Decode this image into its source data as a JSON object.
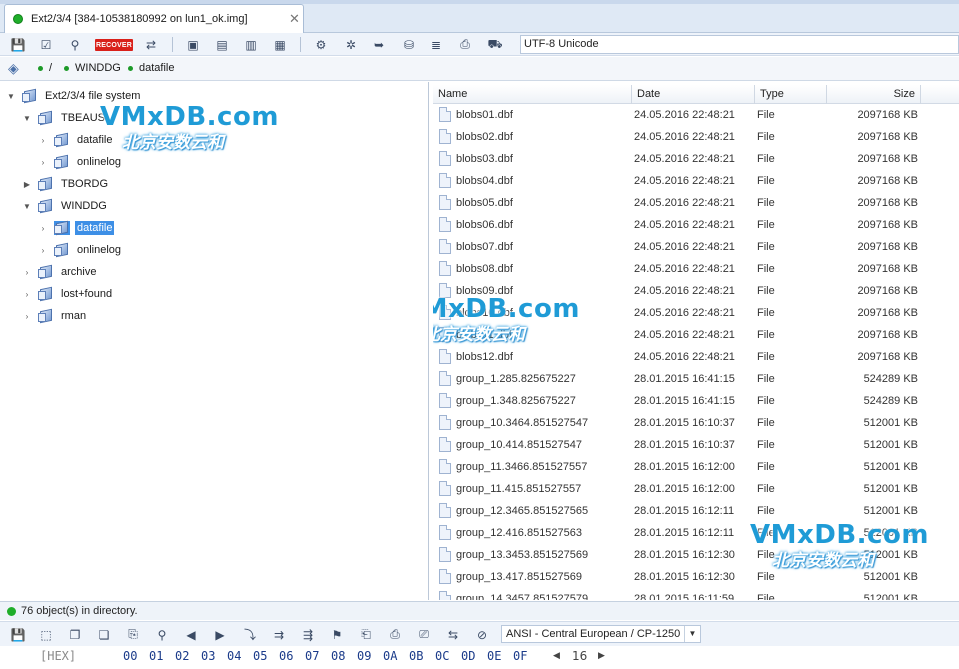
{
  "tab": {
    "title": "Ext2/3/4 [384-10538180992 on lun1_ok.img]",
    "close": "✕"
  },
  "toolbar": {
    "icons": [
      "save-icon",
      "checklist-icon",
      "binoculars-icon",
      "recover-button",
      "transfer-icon",
      "copy-icon",
      "merge-icon",
      "export-icon",
      "table-icon",
      "gear-icon",
      "settings-icon",
      "arrow-icon",
      "database-icon",
      "document-icon",
      "file-icon",
      "package-icon"
    ],
    "recover_label": "RECOVER",
    "encoding": "UTF-8 Unicode"
  },
  "path": {
    "root": "/",
    "folder": "WINDDG",
    "sub": "datafile"
  },
  "tree": {
    "root": "Ext2/3/4 file system",
    "nodes": [
      {
        "label": "TBEAUS"
      },
      {
        "label": "datafile"
      },
      {
        "label": "onlinelog"
      },
      {
        "label": "TBORDG"
      },
      {
        "label": "WINDDG"
      },
      {
        "label": "datafile"
      },
      {
        "label": "onlinelog"
      },
      {
        "label": "archive"
      },
      {
        "label": "lost+found"
      },
      {
        "label": "rman"
      }
    ]
  },
  "columns": {
    "name": "Name",
    "date": "Date",
    "type": "Type",
    "size": "Size"
  },
  "files": [
    {
      "name": "blobs01.dbf",
      "date": "24.05.2016 22:48:21",
      "type": "File",
      "size": "2097168 KB"
    },
    {
      "name": "blobs02.dbf",
      "date": "24.05.2016 22:48:21",
      "type": "File",
      "size": "2097168 KB"
    },
    {
      "name": "blobs03.dbf",
      "date": "24.05.2016 22:48:21",
      "type": "File",
      "size": "2097168 KB"
    },
    {
      "name": "blobs04.dbf",
      "date": "24.05.2016 22:48:21",
      "type": "File",
      "size": "2097168 KB"
    },
    {
      "name": "blobs05.dbf",
      "date": "24.05.2016 22:48:21",
      "type": "File",
      "size": "2097168 KB"
    },
    {
      "name": "blobs06.dbf",
      "date": "24.05.2016 22:48:21",
      "type": "File",
      "size": "2097168 KB"
    },
    {
      "name": "blobs07.dbf",
      "date": "24.05.2016 22:48:21",
      "type": "File",
      "size": "2097168 KB"
    },
    {
      "name": "blobs08.dbf",
      "date": "24.05.2016 22:48:21",
      "type": "File",
      "size": "2097168 KB"
    },
    {
      "name": "blobs09.dbf",
      "date": "24.05.2016 22:48:21",
      "type": "File",
      "size": "2097168 KB"
    },
    {
      "name": "blobs10.dbf",
      "date": "24.05.2016 22:48:21",
      "type": "File",
      "size": "2097168 KB"
    },
    {
      "name": "blobs11.dbf",
      "date": "24.05.2016 22:48:21",
      "type": "File",
      "size": "2097168 KB"
    },
    {
      "name": "blobs12.dbf",
      "date": "24.05.2016 22:48:21",
      "type": "File",
      "size": "2097168 KB"
    },
    {
      "name": "group_1.285.825675227",
      "date": "28.01.2015 16:41:15",
      "type": "File",
      "size": "524289 KB"
    },
    {
      "name": "group_1.348.825675227",
      "date": "28.01.2015 16:41:15",
      "type": "File",
      "size": "524289 KB"
    },
    {
      "name": "group_10.3464.851527547",
      "date": "28.01.2015 16:10:37",
      "type": "File",
      "size": "512001 KB"
    },
    {
      "name": "group_10.414.851527547",
      "date": "28.01.2015 16:10:37",
      "type": "File",
      "size": "512001 KB"
    },
    {
      "name": "group_11.3466.851527557",
      "date": "28.01.2015 16:12:00",
      "type": "File",
      "size": "512001 KB"
    },
    {
      "name": "group_11.415.851527557",
      "date": "28.01.2015 16:12:00",
      "type": "File",
      "size": "512001 KB"
    },
    {
      "name": "group_12.3465.851527565",
      "date": "28.01.2015 16:12:11",
      "type": "File",
      "size": "512001 KB"
    },
    {
      "name": "group_12.416.851527563",
      "date": "28.01.2015 16:12:11",
      "type": "File",
      "size": "512001 KB"
    },
    {
      "name": "group_13.3453.851527569",
      "date": "28.01.2015 16:12:30",
      "type": "File",
      "size": "512001 KB"
    },
    {
      "name": "group_13.417.851527569",
      "date": "28.01.2015 16:12:30",
      "type": "File",
      "size": "512001 KB"
    },
    {
      "name": "group_14.3457.851527579",
      "date": "28.01.2015 16:11:59",
      "type": "File",
      "size": "512001 KB"
    }
  ],
  "watermark": {
    "brand": "VMxDB.com",
    "tagline": "北京安数云和"
  },
  "status": {
    "text": "76 object(s) in directory."
  },
  "toolbar2": {
    "icons": [
      "save-icon",
      "select-icon",
      "copy-icon",
      "paste-icon",
      "paste-special-icon",
      "find-icon",
      "back-icon",
      "forward-icon",
      "goto-icon",
      "bookmark-icon",
      "bookmark-next-icon",
      "flag-icon",
      "export-icon",
      "print-icon",
      "print-setup-icon",
      "swap-icon",
      "no-edit-icon"
    ],
    "encoding": "ANSI - Central European / CP-1250"
  },
  "hex": {
    "label": "[HEX]",
    "columns": [
      "00",
      "01",
      "02",
      "03",
      "04",
      "05",
      "06",
      "07",
      "08",
      "09",
      "0A",
      "0B",
      "0C",
      "0D",
      "0E",
      "0F"
    ],
    "width": "16"
  }
}
